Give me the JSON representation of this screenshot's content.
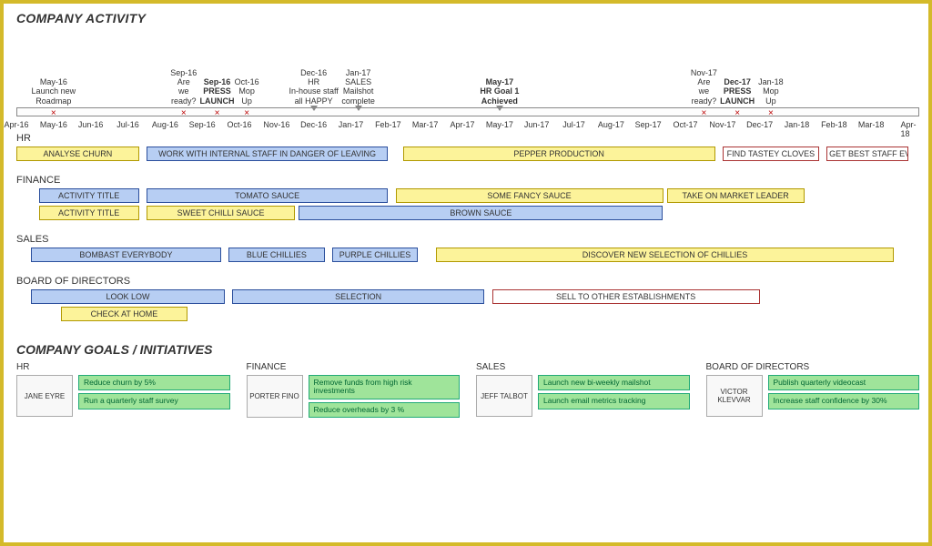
{
  "title_activity": "COMPANY ACTIVITY",
  "title_goals": "COMPANY GOALS / INITIATIVES",
  "timeline": {
    "months": [
      "Apr-16",
      "May-16",
      "Jun-16",
      "Jul-16",
      "Aug-16",
      "Sep-16",
      "Oct-16",
      "Nov-16",
      "Dec-16",
      "Jan-17",
      "Feb-17",
      "Mar-17",
      "Apr-17",
      "May-17",
      "Jun-17",
      "Jul-17",
      "Aug-17",
      "Sep-17",
      "Oct-17",
      "Nov-17",
      "Dec-17",
      "Jan-18",
      "Feb-18",
      "Mar-18",
      "Apr-18"
    ],
    "events": [
      {
        "date": "May-16",
        "text": "Launch new\nRoadmap",
        "at": 1,
        "bold": false,
        "mark": true
      },
      {
        "date": "Sep-16",
        "text": "Are\nwe\nready?",
        "at": 4.5,
        "bold": false,
        "mark": true
      },
      {
        "date": "Sep-16",
        "text": "PRESS\nLAUNCH",
        "at": 5.4,
        "bold": true,
        "mark": true
      },
      {
        "date": "Oct-16",
        "text": "Mop\nUp",
        "at": 6.2,
        "bold": false,
        "mark": true
      },
      {
        "date": "Dec-16",
        "text": "HR\nIn-house staff\nall HAPPY",
        "at": 8,
        "bold": false,
        "mark": false,
        "arrow": true
      },
      {
        "date": "Jan-17",
        "text": "SALES\nMailshot\ncomplete",
        "at": 9.2,
        "bold": false,
        "mark": false,
        "arrow": true
      },
      {
        "date": "May-17",
        "text": "HR Goal 1\nAchieved",
        "at": 13,
        "bold": true,
        "mark": false,
        "arrow": true
      },
      {
        "date": "Nov-17",
        "text": "Are\nwe\nready?",
        "at": 18.5,
        "bold": false,
        "mark": true
      },
      {
        "date": "Dec-17",
        "text": "PRESS\nLAUNCH",
        "at": 19.4,
        "bold": true,
        "mark": true
      },
      {
        "date": "Jan-18",
        "text": "Mop\nUp",
        "at": 20.3,
        "bold": false,
        "mark": true
      }
    ]
  },
  "swimlanes": [
    {
      "name": "HR",
      "rows": [
        [
          {
            "label": "ANALYSE CHURN",
            "start": 0,
            "end": 3.3,
            "color": "yellow"
          },
          {
            "label": "WORK WITH INTERNAL STAFF IN DANGER OF LEAVING",
            "start": 3.5,
            "end": 10,
            "color": "blue"
          },
          {
            "label": "PEPPER PRODUCTION",
            "start": 10.4,
            "end": 18.8,
            "color": "yellow"
          },
          {
            "label": "FIND TASTEY CLOVES",
            "start": 19,
            "end": 21.6,
            "color": "white"
          },
          {
            "label": "GET BEST STAFF EVER",
            "start": 21.8,
            "end": 24,
            "color": "white"
          }
        ]
      ]
    },
    {
      "name": "FINANCE",
      "rows": [
        [
          {
            "label": "ACTIVITY TITLE",
            "start": 0.6,
            "end": 3.3,
            "color": "blue"
          },
          {
            "label": "TOMATO SAUCE",
            "start": 3.5,
            "end": 10,
            "color": "blue"
          },
          {
            "label": "SOME FANCY SAUCE",
            "start": 10.2,
            "end": 17.4,
            "color": "yellow"
          },
          {
            "label": "TAKE ON MARKET LEADER",
            "start": 17.5,
            "end": 21.2,
            "color": "yellow"
          }
        ],
        [
          {
            "label": "ACTIVITY TITLE",
            "start": 0.6,
            "end": 3.3,
            "color": "yellow"
          },
          {
            "label": "SWEET CHILLI SAUCE",
            "start": 3.5,
            "end": 7.5,
            "color": "yellow"
          },
          {
            "label": "BROWN SAUCE",
            "start": 7.6,
            "end": 17.4,
            "color": "blue"
          }
        ]
      ]
    },
    {
      "name": "SALES",
      "rows": [
        [
          {
            "label": "BOMBAST EVERYBODY",
            "start": 0.4,
            "end": 5.5,
            "color": "blue"
          },
          {
            "label": "BLUE CHILLIES",
            "start": 5.7,
            "end": 8.3,
            "color": "blue"
          },
          {
            "label": "PURPLE CHILLIES",
            "start": 8.5,
            "end": 10.8,
            "color": "blue"
          },
          {
            "label": "DISCOVER NEW SELECTION OF CHILLIES",
            "start": 11.3,
            "end": 23.6,
            "color": "yellow"
          }
        ]
      ]
    },
    {
      "name": "BOARD OF DIRECTORS",
      "rows": [
        [
          {
            "label": "LOOK LOW",
            "start": 0.4,
            "end": 5.6,
            "color": "blue"
          },
          {
            "label": "SELECTION",
            "start": 5.8,
            "end": 12.6,
            "color": "blue"
          },
          {
            "label": "SELL TO OTHER ESTABLISHMENTS",
            "start": 12.8,
            "end": 20,
            "color": "white"
          }
        ],
        [
          {
            "label": "CHECK AT HOME",
            "start": 1.2,
            "end": 4.6,
            "color": "yellow"
          }
        ]
      ]
    }
  ],
  "goals": [
    {
      "dept": "HR",
      "owner": "JANE EYRE",
      "items": [
        "Reduce churn by 5%",
        "Run a quarterly staff survey"
      ]
    },
    {
      "dept": "FINANCE",
      "owner": "PORTER FINO",
      "items": [
        "Remove funds from high risk investments",
        "Reduce overheads by 3 %"
      ]
    },
    {
      "dept": "SALES",
      "owner": "JEFF TALBOT",
      "items": [
        "Launch new bi-weekly mailshot",
        "Launch email metrics tracking"
      ]
    },
    {
      "dept": "BOARD OF DIRECTORS",
      "owner": "VICTOR KLEVVAR",
      "items": [
        "Publish quarterly videocast",
        "Increase staff confidence by 30%"
      ]
    }
  ],
  "chart_data": {
    "type": "gantt-roadmap",
    "x_axis_start": "Apr-16",
    "x_axis_end": "Apr-18",
    "note": "Positions given as month-index offsets from Apr-16 (0..24). Colors: yellow=#fcf39a blue=#b7cef3 white=#fff(red-border). See swimlanes/timeline keys above for full dataset."
  }
}
